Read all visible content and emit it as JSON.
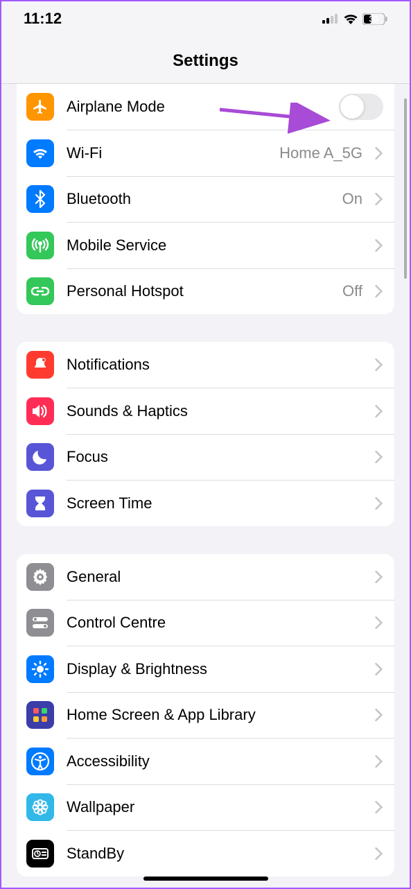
{
  "status_bar": {
    "time": "11:12",
    "battery_level": "30"
  },
  "header": {
    "title": "Settings"
  },
  "groups": [
    {
      "rows": [
        {
          "id": "airplane",
          "label": "Airplane Mode",
          "type": "toggle",
          "state": "off",
          "icon": "airplane",
          "color": "#ff9500"
        },
        {
          "id": "wifi",
          "label": "Wi-Fi",
          "value": "Home A_5G",
          "type": "nav",
          "icon": "wifi",
          "color": "#007aff"
        },
        {
          "id": "bluetooth",
          "label": "Bluetooth",
          "value": "On",
          "type": "nav",
          "icon": "bluetooth",
          "color": "#007aff"
        },
        {
          "id": "mobile",
          "label": "Mobile Service",
          "type": "nav",
          "icon": "antenna",
          "color": "#34c759"
        },
        {
          "id": "hotspot",
          "label": "Personal Hotspot",
          "value": "Off",
          "type": "nav",
          "icon": "link",
          "color": "#34c759"
        }
      ]
    },
    {
      "rows": [
        {
          "id": "notifications",
          "label": "Notifications",
          "type": "nav",
          "icon": "bell",
          "color": "#ff3b30"
        },
        {
          "id": "sounds",
          "label": "Sounds & Haptics",
          "type": "nav",
          "icon": "speaker",
          "color": "#ff3b62"
        },
        {
          "id": "focus",
          "label": "Focus",
          "type": "nav",
          "icon": "moon",
          "color": "#5856d6"
        },
        {
          "id": "screentime",
          "label": "Screen Time",
          "type": "nav",
          "icon": "hourglass",
          "color": "#5856d6"
        }
      ]
    },
    {
      "rows": [
        {
          "id": "general",
          "label": "General",
          "type": "nav",
          "icon": "gear",
          "color": "#8e8e93"
        },
        {
          "id": "controlcentre",
          "label": "Control Centre",
          "type": "nav",
          "icon": "switches",
          "color": "#8e8e93"
        },
        {
          "id": "display",
          "label": "Display & Brightness",
          "type": "nav",
          "icon": "sun",
          "color": "#007aff"
        },
        {
          "id": "homescreen",
          "label": "Home Screen & App Library",
          "type": "nav",
          "icon": "grid",
          "color": "#4a55c7"
        },
        {
          "id": "accessibility",
          "label": "Accessibility",
          "type": "nav",
          "icon": "person",
          "color": "#007aff"
        },
        {
          "id": "wallpaper",
          "label": "Wallpaper",
          "type": "nav",
          "icon": "flower",
          "color": "#40b8e8"
        },
        {
          "id": "standby",
          "label": "StandBy",
          "type": "nav",
          "icon": "clock",
          "color": "#000000"
        }
      ]
    }
  ]
}
